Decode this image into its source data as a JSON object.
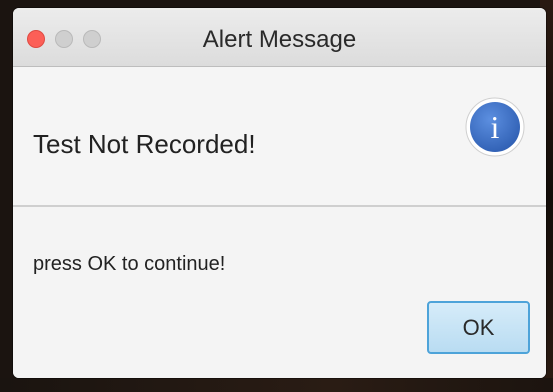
{
  "window": {
    "title": "Alert Message",
    "controls": {
      "close": "close-icon",
      "minimize": "minimize-icon",
      "maximize": "maximize-icon"
    }
  },
  "header": {
    "text": "Test Not Recorded!",
    "icon": "info-icon",
    "icon_glyph": "i",
    "icon_color": "#3a6fc4"
  },
  "content": {
    "text": "press OK to continue!"
  },
  "buttons": {
    "ok_label": "OK"
  },
  "colors": {
    "close": "#fc5f57",
    "button_border": "#4da3d9",
    "button_fill": "#c8e5f6"
  }
}
